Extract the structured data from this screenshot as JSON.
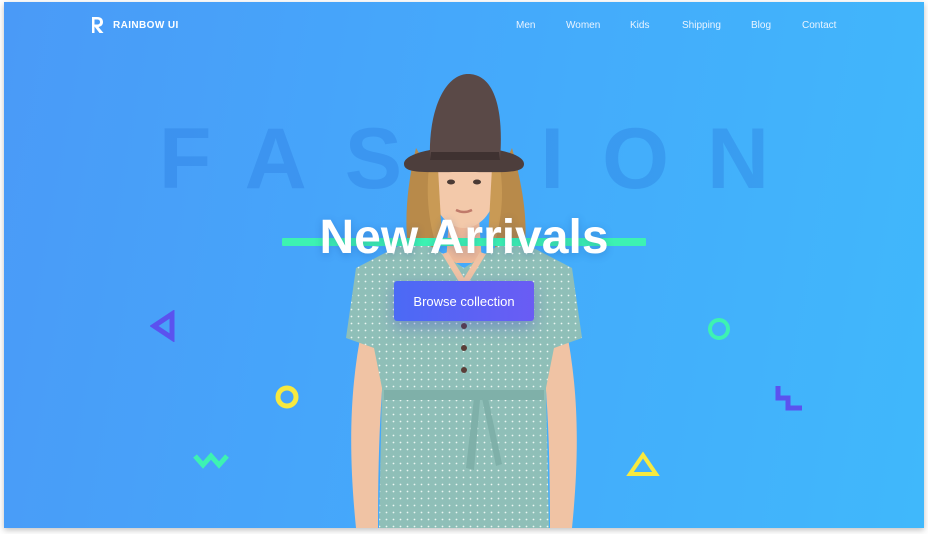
{
  "brand": {
    "name": "RAINBOW UI",
    "logo_icon": "rainbow-ui-logo-icon"
  },
  "nav": {
    "items": [
      {
        "label": "Men"
      },
      {
        "label": "Women"
      },
      {
        "label": "Kids"
      },
      {
        "label": "Shipping"
      },
      {
        "label": "Blog"
      },
      {
        "label": "Contact"
      }
    ]
  },
  "hero": {
    "backdrop_word": "FASHION",
    "headline": "New Arrivals",
    "cta_label": "Browse collection"
  },
  "colors": {
    "background_start": "#4a9af7",
    "background_end": "#40b8fb",
    "accent_green": "#3df2b2",
    "accent_yellow": "#f7e93f",
    "accent_purple": "#5b52ef",
    "button_start": "#4b6af5",
    "button_end": "#6a5cf4"
  },
  "decorations": [
    {
      "icon": "triangle-left-icon"
    },
    {
      "icon": "ring-icon"
    },
    {
      "icon": "zigzag-icon"
    },
    {
      "icon": "triangle-icon"
    },
    {
      "icon": "step-icon"
    }
  ]
}
